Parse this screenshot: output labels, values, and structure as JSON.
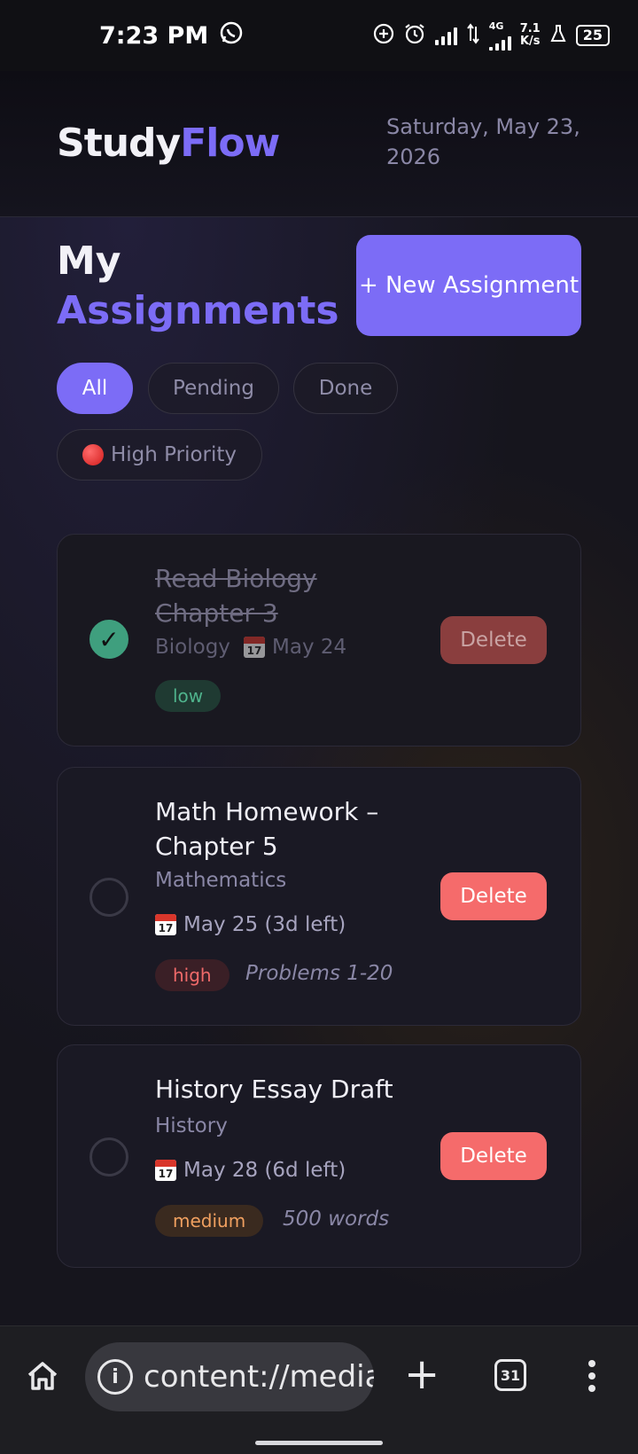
{
  "status_bar": {
    "time": "7:23 PM",
    "net_type": "4G",
    "net_speed_value": "7.1",
    "net_speed_unit": "K/s",
    "battery": "25"
  },
  "header": {
    "logo_part1": "Study",
    "logo_part2": "Flow",
    "date": "Saturday, May 23, 2026"
  },
  "page": {
    "title_line1": "My",
    "title_line2": "Assignments",
    "new_button": "+ New Assignment"
  },
  "filters": {
    "all": "All",
    "pending": "Pending",
    "done": "Done",
    "high_priority": "High Priority"
  },
  "assignments": [
    {
      "title": "Read Biology Chapter 3",
      "subject": "Biology",
      "due": "May 24",
      "priority": "low",
      "note": "",
      "done": true,
      "delete_label": "Delete"
    },
    {
      "title": "Math Homework – Chapter 5",
      "subject": "Mathematics",
      "due": "May 25 (3d left)",
      "priority": "high",
      "note": "Problems 1-20",
      "done": false,
      "delete_label": "Delete"
    },
    {
      "title": "History Essay Draft",
      "subject": "History",
      "due": "May 28 (6d left)",
      "priority": "medium",
      "note": "500 words",
      "done": false,
      "delete_label": "Delete"
    }
  ],
  "browser": {
    "url": "content://media",
    "tab_count": "31"
  },
  "colors": {
    "accent": "#7c6cf6",
    "danger": "#f56b6b",
    "done_green": "#3f9f7e"
  }
}
